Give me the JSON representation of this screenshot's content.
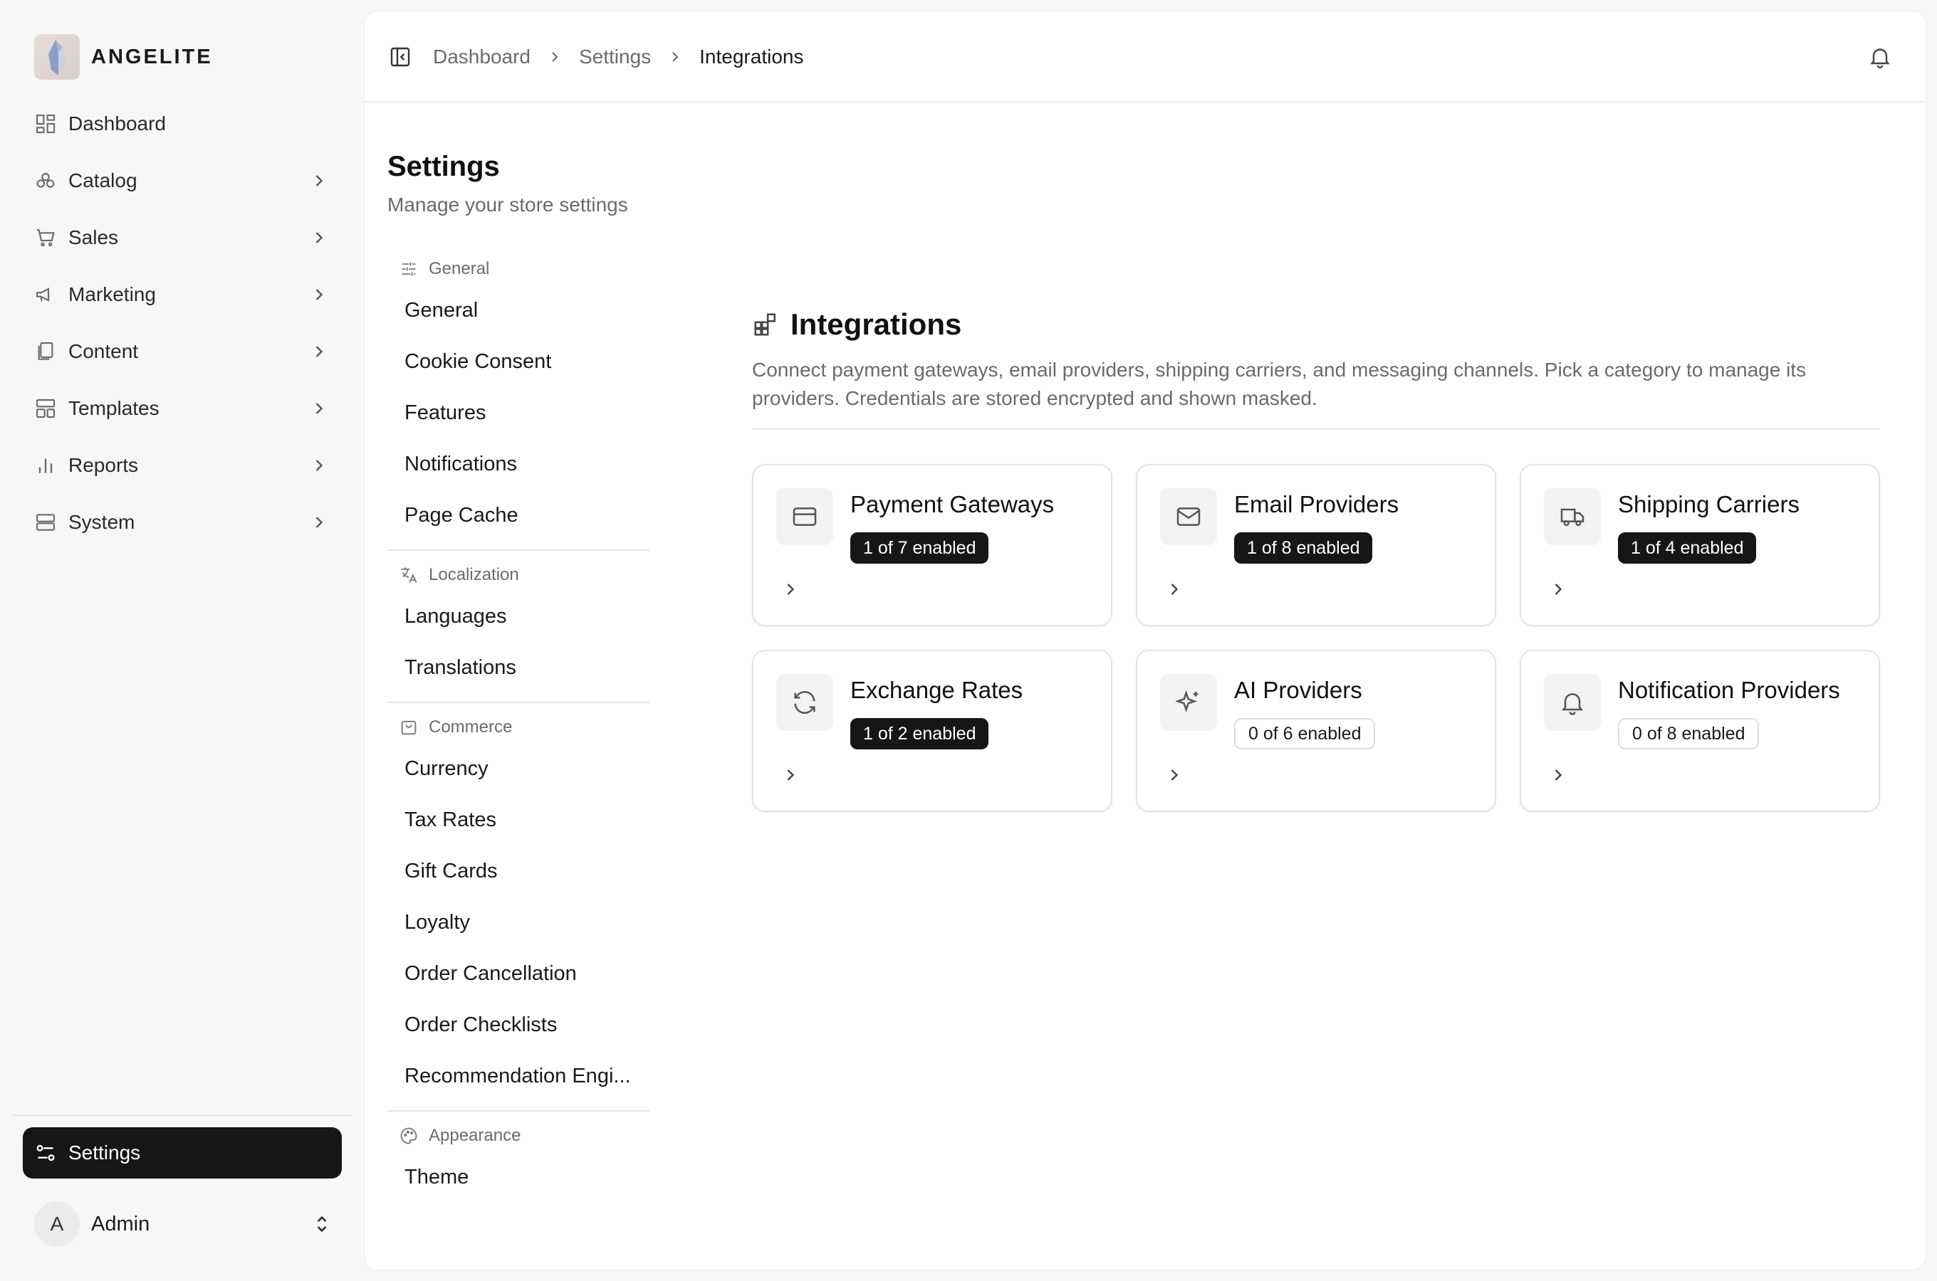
{
  "brand": {
    "name": "ANGELITE",
    "logo_icon": "crystal-logo"
  },
  "sidebar": {
    "items": [
      {
        "label": "Dashboard",
        "icon": "dashboard-icon",
        "has_children": false
      },
      {
        "label": "Catalog",
        "icon": "catalog-icon",
        "has_children": true
      },
      {
        "label": "Sales",
        "icon": "cart-icon",
        "has_children": true
      },
      {
        "label": "Marketing",
        "icon": "megaphone-icon",
        "has_children": true
      },
      {
        "label": "Content",
        "icon": "content-icon",
        "has_children": true
      },
      {
        "label": "Templates",
        "icon": "templates-icon",
        "has_children": true
      },
      {
        "label": "Reports",
        "icon": "bar-chart-icon",
        "has_children": true
      },
      {
        "label": "System",
        "icon": "server-icon",
        "has_children": true
      }
    ],
    "settings_label": "Settings",
    "user": {
      "initial": "A",
      "name": "Admin"
    }
  },
  "breadcrumb": [
    "Dashboard",
    "Settings",
    "Integrations"
  ],
  "page": {
    "title": "Settings",
    "subtitle": "Manage your store settings"
  },
  "subnav": {
    "groups": [
      {
        "heading": "General",
        "icon": "sliders-icon",
        "items": [
          "General",
          "Cookie Consent",
          "Features",
          "Notifications",
          "Page Cache"
        ]
      },
      {
        "heading": "Localization",
        "icon": "translate-icon",
        "items": [
          "Languages",
          "Translations"
        ]
      },
      {
        "heading": "Commerce",
        "icon": "shopping-bag-icon",
        "items": [
          "Currency",
          "Tax Rates",
          "Gift Cards",
          "Loyalty",
          "Order Cancellation",
          "Order Checklists",
          "Recommendation Engi..."
        ]
      },
      {
        "heading": "Appearance",
        "icon": "palette-icon",
        "items": [
          "Theme"
        ]
      }
    ]
  },
  "integrations": {
    "title": "Integrations",
    "description": "Connect payment gateways, email providers, shipping carriers, and messaging channels. Pick a category to manage its providers. Credentials are stored encrypted and shown masked.",
    "cards": [
      {
        "title": "Payment Gateways",
        "badge": "1 of 7 enabled",
        "enabled": true,
        "icon": "credit-card-icon"
      },
      {
        "title": "Email Providers",
        "badge": "1 of 8 enabled",
        "enabled": true,
        "icon": "mail-icon"
      },
      {
        "title": "Shipping Carriers",
        "badge": "1 of 4 enabled",
        "enabled": true,
        "icon": "truck-icon"
      },
      {
        "title": "Exchange Rates",
        "badge": "1 of 2 enabled",
        "enabled": true,
        "icon": "refresh-icon"
      },
      {
        "title": "AI Providers",
        "badge": "0 of 6 enabled",
        "enabled": false,
        "icon": "sparkles-icon"
      },
      {
        "title": "Notification Providers",
        "badge": "0 of 8 enabled",
        "enabled": false,
        "icon": "bell-icon"
      }
    ]
  }
}
